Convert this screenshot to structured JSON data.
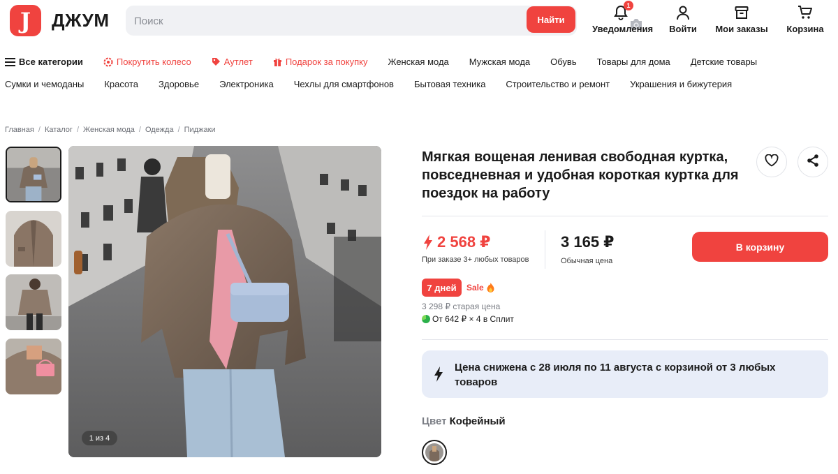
{
  "header": {
    "logo_letter": "J",
    "brand": "ДЖУМ",
    "search": {
      "placeholder": "Поиск",
      "button_label": "Найти"
    },
    "actions": {
      "notifications": {
        "label": "Уведомления",
        "badge": "1",
        "icon": "bell-icon"
      },
      "login": {
        "label": "Войти",
        "icon": "user-icon"
      },
      "orders": {
        "label": "Мои заказы",
        "icon": "box-icon"
      },
      "cart": {
        "label": "Корзина",
        "icon": "cart-icon"
      }
    }
  },
  "nav": {
    "row1": [
      {
        "label": "Все категории",
        "icon": "menu-icon",
        "style": "bold"
      },
      {
        "label": "Покрутить колесо",
        "icon": "wheel-icon",
        "style": "red"
      },
      {
        "label": "Аутлет",
        "icon": "tag-icon",
        "style": "red"
      },
      {
        "label": "Подарок за покупку",
        "icon": "gift-icon",
        "style": "red"
      },
      {
        "label": "Женская мода"
      },
      {
        "label": "Мужская мода"
      },
      {
        "label": "Обувь"
      },
      {
        "label": "Товары для дома"
      },
      {
        "label": "Детские товары"
      }
    ],
    "row2": [
      {
        "label": "Сумки и чемоданы"
      },
      {
        "label": "Красота"
      },
      {
        "label": "Здоровье"
      },
      {
        "label": "Электроника"
      },
      {
        "label": "Чехлы для смартфонов"
      },
      {
        "label": "Бытовая техника"
      },
      {
        "label": "Строительство и ремонт"
      },
      {
        "label": "Украшения и бижутерия"
      }
    ]
  },
  "breadcrumb": [
    "Главная",
    "Каталог",
    "Женская мода",
    "Одежда",
    "Пиджаки"
  ],
  "gallery": {
    "counter": "1 из 4",
    "thumbnail_count": 4,
    "active_index": 0
  },
  "product": {
    "title": "Мягкая вощеная ленивая свободная куртка, повседневная и удобная короткая куртка для поездок на работу",
    "price_promo": "2 568 ₽",
    "price_promo_note": "При заказе 3+ любых товаров",
    "price_regular": "3 165 ₽",
    "price_regular_note": "Обычная цена",
    "cart_button": "В корзину",
    "days_badge": "7 дней",
    "sale_label": "Sale",
    "old_price": "3 298 ₽ старая цена",
    "split_text": "От 642 ₽ × 4 в Сплит",
    "info_text": "Цена снижена с 28 июля по 11 августа с корзиной от 3 любых товаров",
    "color_label": "Цвет",
    "color_value": "Кофейный"
  },
  "colors": {
    "accent": "#f0433f",
    "info_bg": "#e8edf8",
    "search_bg": "#f0f1f4"
  }
}
